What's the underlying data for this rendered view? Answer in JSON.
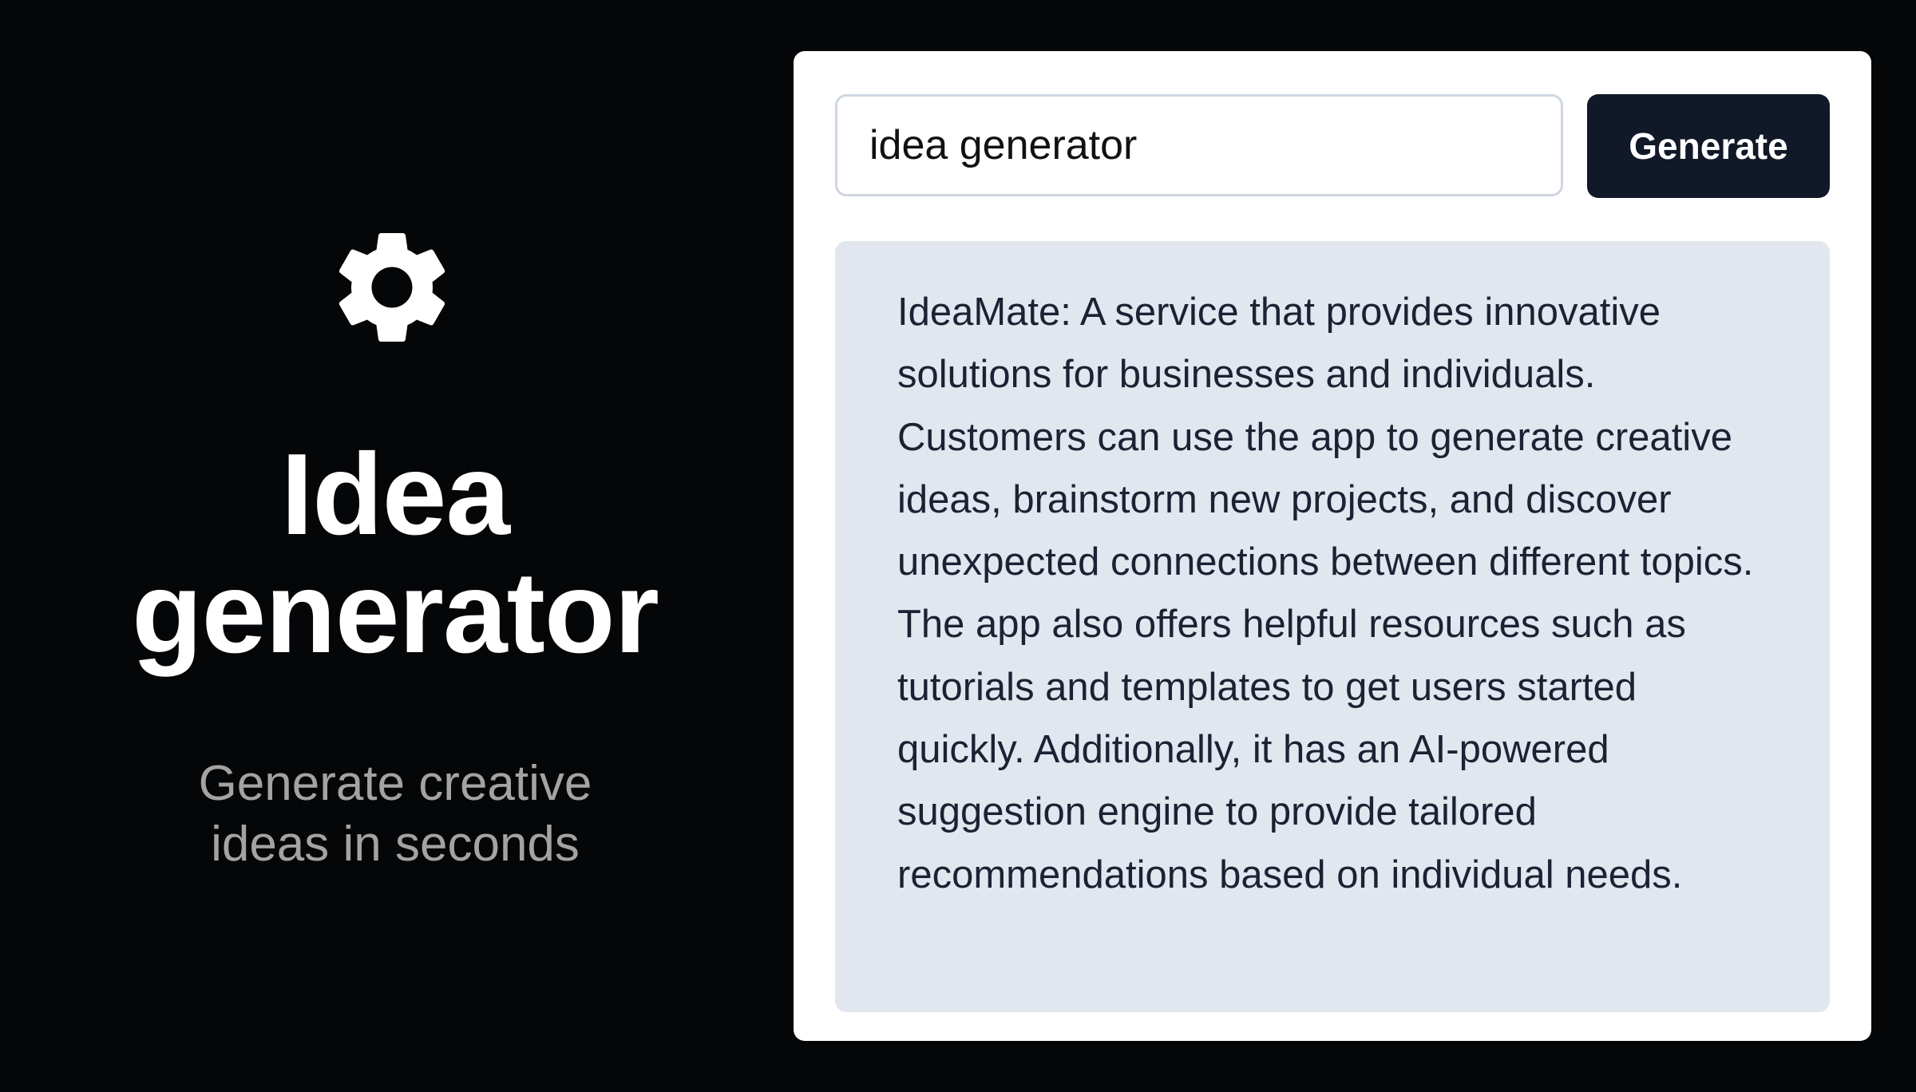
{
  "hero": {
    "icon": "gear-icon",
    "title_line1": "Idea",
    "title_line2": "generator",
    "subtitle_line1": "Generate creative",
    "subtitle_line2": "ideas in seconds"
  },
  "form": {
    "input_value": "idea generator",
    "button_label": "Generate"
  },
  "result": {
    "text": "IdeaMate: A service that provides innovative solutions for businesses and individuals. Customers can use the app to generate creative ideas, brainstorm new projects, and discover unexpected connections between different topics. The app also offers helpful resources such as tutorials and templates to get users started quickly. Additionally, it has an AI-powered suggestion engine to provide tailored recommendations based on individual needs."
  },
  "colors": {
    "background": "#050608",
    "card": "#ffffff",
    "button": "#111827",
    "result_panel": "#e2e6ee",
    "subtitle": "#a3a3a3"
  }
}
